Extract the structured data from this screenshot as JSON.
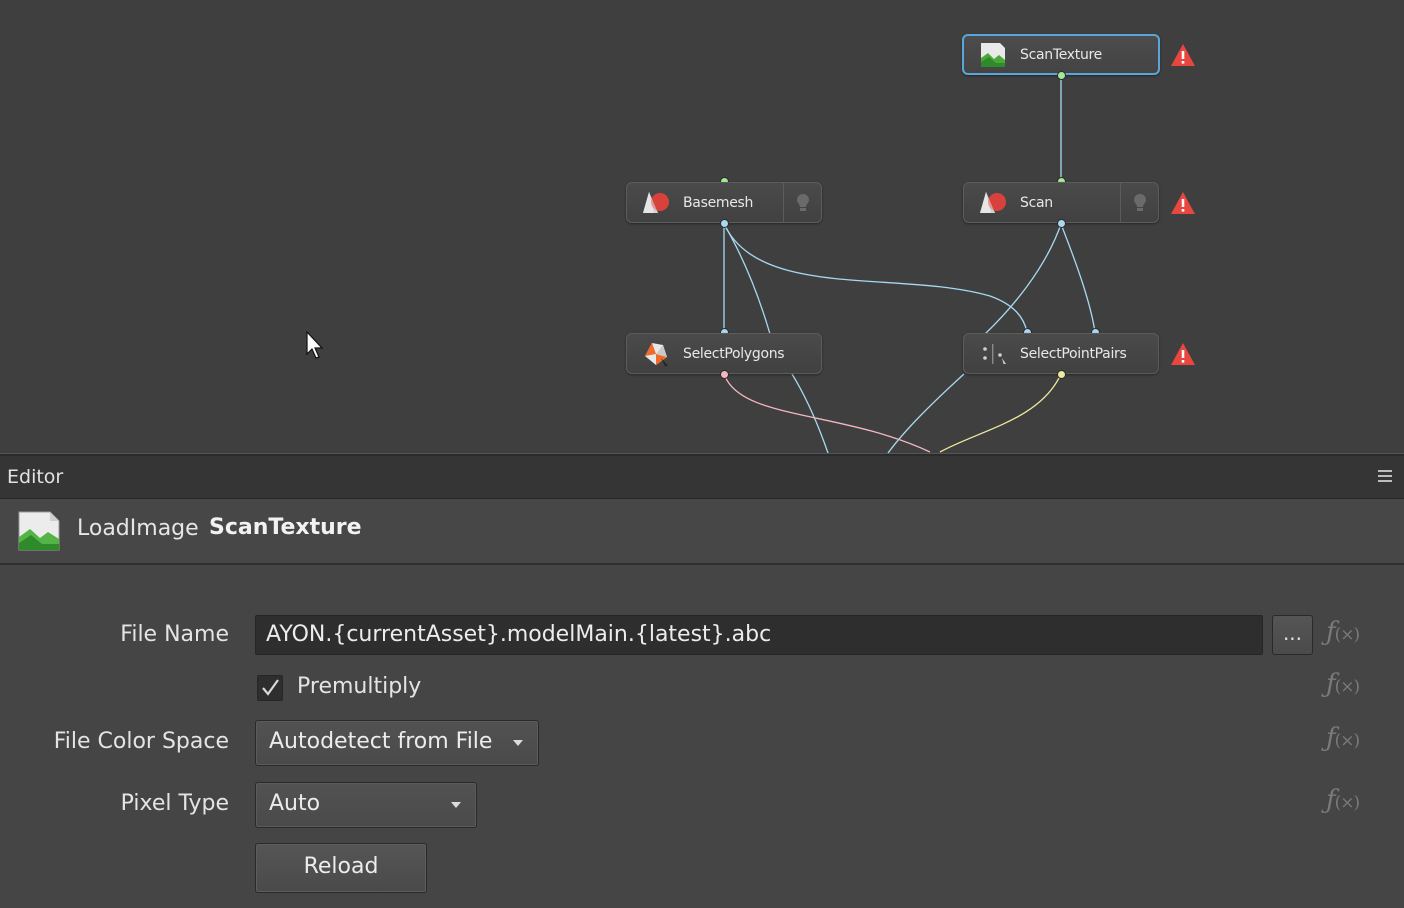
{
  "graph": {
    "nodes": {
      "scan_texture": {
        "label": "ScanTexture",
        "selected": true,
        "warning": true,
        "icon": "image-icon"
      },
      "basemesh": {
        "label": "Basemesh",
        "warning": false,
        "icon": "mesh-icon"
      },
      "scan": {
        "label": "Scan",
        "warning": true,
        "icon": "mesh-icon"
      },
      "select_polygons": {
        "label": "SelectPolygons",
        "warning": false,
        "icon": "select-polygons-icon"
      },
      "select_point_pairs": {
        "label": "SelectPointPairs",
        "warning": true,
        "icon": "point-pairs-icon"
      }
    },
    "colors": {
      "wire_blue": "#a9d8f0",
      "wire_pink": "#f3b6c4",
      "wire_yellow": "#eeeaa0",
      "selection": "#5aa6d6",
      "warning": "#e8473f"
    }
  },
  "editor": {
    "title": "Editor",
    "node_type": "LoadImage",
    "node_name": "ScanTexture",
    "params": {
      "file_name": {
        "label": "File Name",
        "value": "AYON.{currentAsset}.modelMain.{latest}.abc",
        "browse_label": "..."
      },
      "premultiply": {
        "label": "Premultiply",
        "checked": true
      },
      "file_color_space": {
        "label": "File Color Space",
        "value": "Autodetect from File"
      },
      "pixel_type": {
        "label": "Pixel Type",
        "value": "Auto"
      },
      "reload": {
        "label": "Reload"
      }
    },
    "fx_label": "f(x)"
  }
}
